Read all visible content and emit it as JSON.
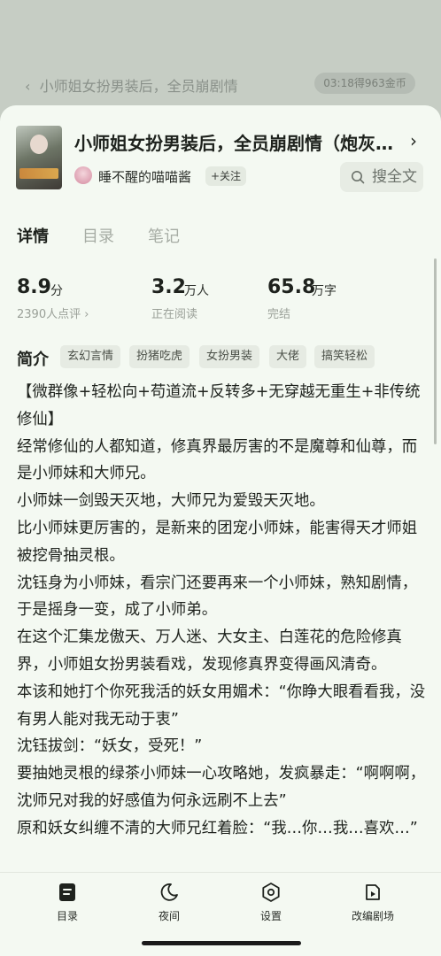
{
  "background": {
    "title": "小师姐女扮男装后，全员崩剧情",
    "reward": "03:18得963金币"
  },
  "book": {
    "title": "小师姐女扮男装后，全员崩剧情（炮灰…",
    "author": "睡不醒的喵喵酱",
    "follow_label": "+关注",
    "search_label": "搜全文"
  },
  "tabs": [
    {
      "label": "详情",
      "active": true
    },
    {
      "label": "目录",
      "active": false
    },
    {
      "label": "笔记",
      "active": false
    }
  ],
  "stats": [
    {
      "value": "8.9",
      "unit": "分",
      "sub": "2390人点评 ›"
    },
    {
      "value": "3.2",
      "unit": "万人",
      "sub": "正在阅读"
    },
    {
      "value": "65.8",
      "unit": "万字",
      "sub": "完结"
    }
  ],
  "intro": {
    "label": "简介",
    "tags": [
      "玄幻言情",
      "扮猪吃虎",
      "女扮男装",
      "大佬",
      "搞笑轻松"
    ]
  },
  "description": [
    "【微群像+轻松向+苟道流+反转多+无穿越无重生+非传统修仙】",
    "经常修仙的人都知道，修真界最厉害的不是魔尊和仙尊，而是小师妹和大师兄。",
    "小师妹一剑毁天灭地，大师兄为爱毁天灭地。",
    "比小师妹更厉害的，是新来的团宠小师妹，能害得天才师姐被挖骨抽灵根。",
    "沈钰身为小师妹，看宗门还要再来一个小师妹，熟知剧情，于是摇身一变，成了小师弟。",
    "在这个汇集龙傲天、万人迷、大女主、白莲花的危险修真界，小师姐女扮男装看戏，发现修真界变得画风清奇。",
    "本该和她打个你死我活的妖女用媚术：“你睁大眼看看我，没有男人能对我无动于衷”",
    "沈钰拔剑：“妖女，受死！”",
    "要抽她灵根的绿茶小师妹一心攻略她，发疯暴走：“啊啊啊，沈师兄对我的好感值为何永远刷不上去”",
    "原和妖女纠缠不清的大师兄红着脸：“我…你…我…喜欢…”"
  ],
  "bottom_nav": [
    {
      "label": "目录",
      "icon": "book-list-icon"
    },
    {
      "label": "夜间",
      "icon": "moon-icon"
    },
    {
      "label": "设置",
      "icon": "settings-icon"
    },
    {
      "label": "改编剧场",
      "icon": "video-play-icon"
    }
  ]
}
